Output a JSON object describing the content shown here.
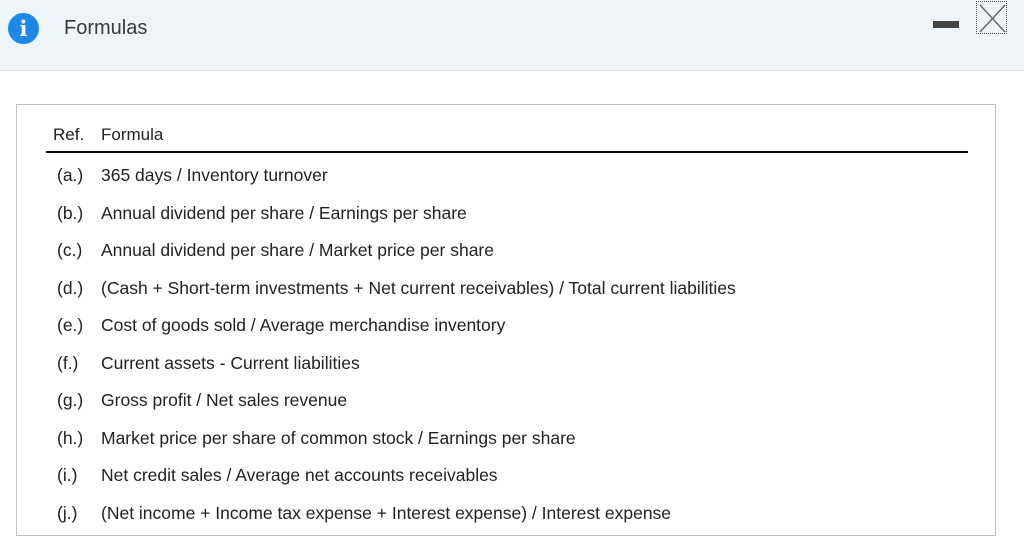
{
  "window": {
    "title": "Formulas",
    "icon": "info-icon",
    "minimize_icon": "minimize-icon",
    "close_icon": "close-icon"
  },
  "table": {
    "headers": {
      "ref": "Ref.",
      "formula": "Formula"
    },
    "rows": [
      {
        "ref": "(a.)",
        "formula": "365 days / Inventory turnover"
      },
      {
        "ref": "(b.)",
        "formula": "Annual dividend per share / Earnings per share"
      },
      {
        "ref": "(c.)",
        "formula": "Annual dividend per share / Market price per share"
      },
      {
        "ref": "(d.)",
        "formula": "(Cash + Short-term investments + Net current receivables) / Total current liabilities"
      },
      {
        "ref": "(e.)",
        "formula": "Cost of goods sold / Average merchandise inventory"
      },
      {
        "ref": "(f.)",
        "formula": "Current assets - Current liabilities"
      },
      {
        "ref": "(g.)",
        "formula": "Gross profit / Net sales revenue"
      },
      {
        "ref": "(h.)",
        "formula": "Market price per share of common stock / Earnings per share"
      },
      {
        "ref": "(i.)",
        "formula": "Net credit sales / Average net accounts receivables"
      },
      {
        "ref": "(j.)",
        "formula": "(Net income + Income tax expense + Interest expense) / Interest expense"
      }
    ]
  },
  "colors": {
    "header_bg": "#edf4fb",
    "info_blue": "#1e88e5",
    "text": "#222222",
    "border": "#c4c4c4"
  }
}
